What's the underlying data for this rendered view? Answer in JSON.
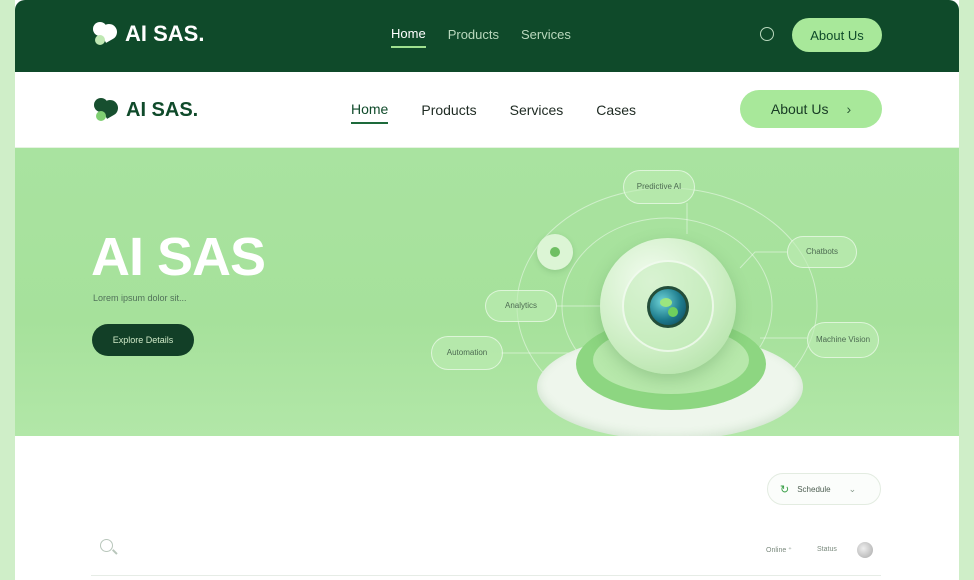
{
  "top_header": {
    "brand": "AI SAS.",
    "nav": [
      "Home",
      "Products",
      "Services"
    ],
    "active_index": 0,
    "cta": "About Us"
  },
  "main_header": {
    "brand": "AI SAS.",
    "nav": [
      "Home",
      "Products",
      "Services",
      "Cases"
    ],
    "active_index": 0,
    "cta": "About Us",
    "cta_icon": "chevron-right-icon"
  },
  "hero": {
    "title": "AI SAS",
    "subtitle": "Lorem ipsum dolor sit...",
    "button": "Explore Details",
    "nodes": [
      "Predictive AI",
      "Chatbots",
      "Analytics",
      "Automation",
      "Machine Vision"
    ]
  },
  "toolbar": {
    "select_label": "Schedule",
    "meta_left": "Online ⁺",
    "meta_right": "Status"
  },
  "colors": {
    "dark_green": "#0f4a2a",
    "accent_green": "#a8e89a",
    "hero_bg": "#a9e3a0"
  }
}
